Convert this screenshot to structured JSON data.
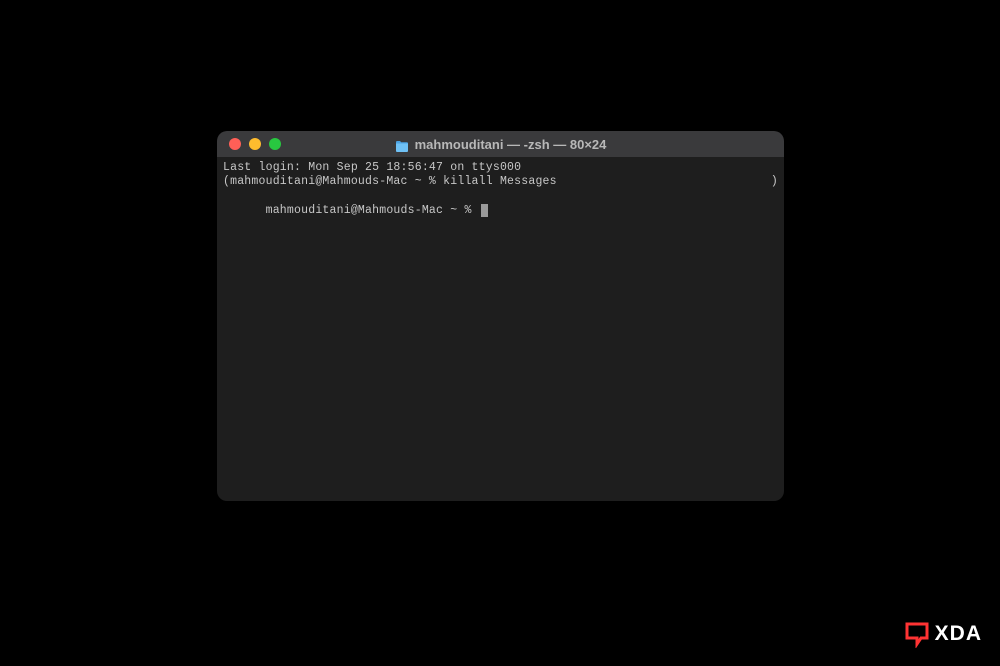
{
  "window": {
    "title": "mahmouditani — -zsh — 80×24"
  },
  "terminal": {
    "lastLogin": "Last login: Mon Sep 25 18:56:47 on ttys000",
    "line2Left": "(mahmouditani@Mahmouds-Mac ~ % killall Messages",
    "line2Right": ")",
    "prompt": "mahmouditani@Mahmouds-Mac ~ % "
  },
  "watermark": {
    "text": "XDA"
  }
}
